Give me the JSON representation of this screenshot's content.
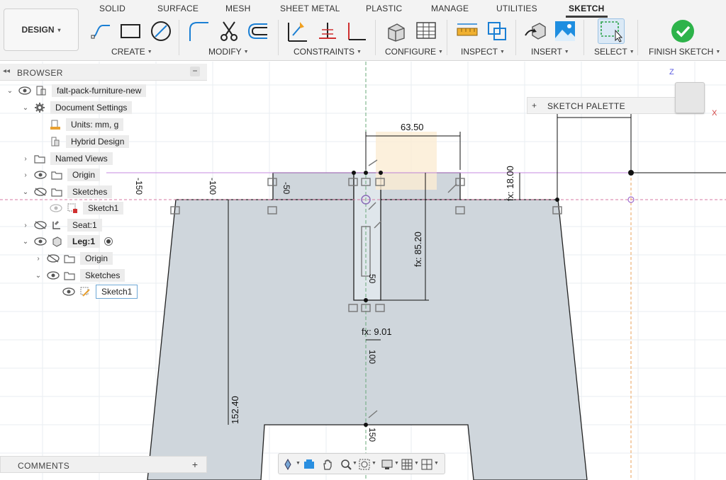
{
  "tabs": [
    "SOLID",
    "SURFACE",
    "MESH",
    "SHEET METAL",
    "PLASTIC",
    "MANAGE",
    "UTILITIES",
    "SKETCH"
  ],
  "active_tab": "SKETCH",
  "workspace": {
    "label": "DESIGN",
    "caret": "▾"
  },
  "toolbar_groups": {
    "create": "CREATE",
    "modify": "MODIFY",
    "constraints": "CONSTRAINTS",
    "configure": "CONFIGURE",
    "inspect": "INSPECT",
    "insert": "INSERT",
    "select": "SELECT",
    "finish": "FINISH SKETCH"
  },
  "browser": {
    "title": "BROWSER",
    "items": [
      {
        "label": "falt-pack-furniture-new"
      },
      {
        "label": "Document Settings"
      },
      {
        "label": "Units: mm, g"
      },
      {
        "label": "Hybrid Design"
      },
      {
        "label": "Named Views"
      },
      {
        "label": "Origin"
      },
      {
        "label": "Sketches"
      },
      {
        "label": "Sketch1"
      },
      {
        "label": "Seat:1"
      },
      {
        "label": "Leg:1"
      },
      {
        "label": "Origin"
      },
      {
        "label": "Sketches"
      },
      {
        "label": "Sketch1"
      }
    ]
  },
  "sketch_palette": {
    "title": "SKETCH PALETTE",
    "plus": "+"
  },
  "viewcube": {
    "z_label": "Z",
    "x_label": "X"
  },
  "comments": {
    "title": "COMMENTS",
    "plus": "+"
  },
  "ruler_labels": [
    "-150",
    "-100",
    "-50",
    "50",
    "100",
    "150"
  ],
  "dimensions": {
    "top_width": "63.50",
    "tab_height": "fx: 18.00",
    "slot_depth": "fx: 85.20",
    "slot_width": "fx: 9.01",
    "leg_height": "152.40"
  },
  "colors": {
    "toolbar_bg": "#f3f3f3",
    "sketch_fill": "#cfd6dc",
    "accent_blue": "#1a7fd4",
    "finish_green": "#2db34a"
  }
}
